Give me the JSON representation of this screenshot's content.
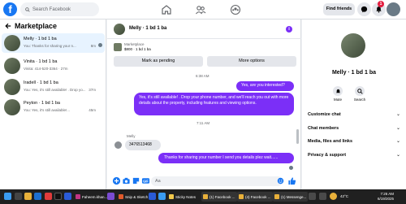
{
  "topnav": {
    "logo": "f",
    "search_placeholder": "Search Facebook",
    "find_friends_label": "Find friends",
    "notification_count": "1"
  },
  "sidebar": {
    "title": "Marketplace",
    "conversations": [
      {
        "name": "Melly · 1 bd 1 ba",
        "snippet": "You: Thanks for sharing your n...",
        "time": "8m",
        "active": true
      },
      {
        "name": "Vinita · 1 bd 1 ba",
        "snippet": "Vinita: 414-520-3364 · 27m",
        "time": ""
      },
      {
        "name": "Iradell · 1 bd 1 ba",
        "snippet": "You: Yes, it's still available! . Drop yo...",
        "time": "37m"
      },
      {
        "name": "Peyton · 1 bd 1 ba",
        "snippet": "You: Yes, it's still available!...",
        "time": "45m"
      }
    ]
  },
  "chat": {
    "header_name": "Melly · 1 bd 1 ba",
    "marketplace_label": "Marketplace",
    "listing_price": "$800 · 1 bd 1 ba",
    "mark_pending_label": "Mark as pending",
    "more_options_label": "More options",
    "messages": [
      {
        "type": "timestamp",
        "text": "6:38 AM"
      },
      {
        "type": "out",
        "text": "Yes, are you interested?"
      },
      {
        "type": "out",
        "text": "Yes, it's still available! . Drop  your phone number, and we'll reach you out with more details about the property, including features and viewing options."
      },
      {
        "type": "timestamp",
        "text": "7:11 AM"
      },
      {
        "type": "sender",
        "text": "Melly"
      },
      {
        "type": "in",
        "text": "3476513468"
      },
      {
        "type": "out",
        "text": "Thanks for sharing your number I send you details plez wait......"
      }
    ],
    "composer_placeholder": "Aa"
  },
  "right_panel": {
    "name": "Melly · 1 bd 1 ba",
    "mute_label": "Mute",
    "search_label": "Search",
    "rows": [
      "Customize chat",
      "Chat members",
      "Media, files and links",
      "Privacy & support"
    ]
  },
  "taskbar": {
    "apps": [
      "Faheem.khan...",
      "Snip & Sketch",
      "Sticky Notes",
      "(1) Facebook ...",
      "(4) Facebook ...",
      "(1) Messenge..."
    ],
    "weather": "42°C",
    "time": "7:26 AM",
    "date": "6/19/2025"
  },
  "colors": {
    "accent": "#7b2ff7",
    "facebook_blue": "#1877f2",
    "background": "#f0f2f5"
  }
}
